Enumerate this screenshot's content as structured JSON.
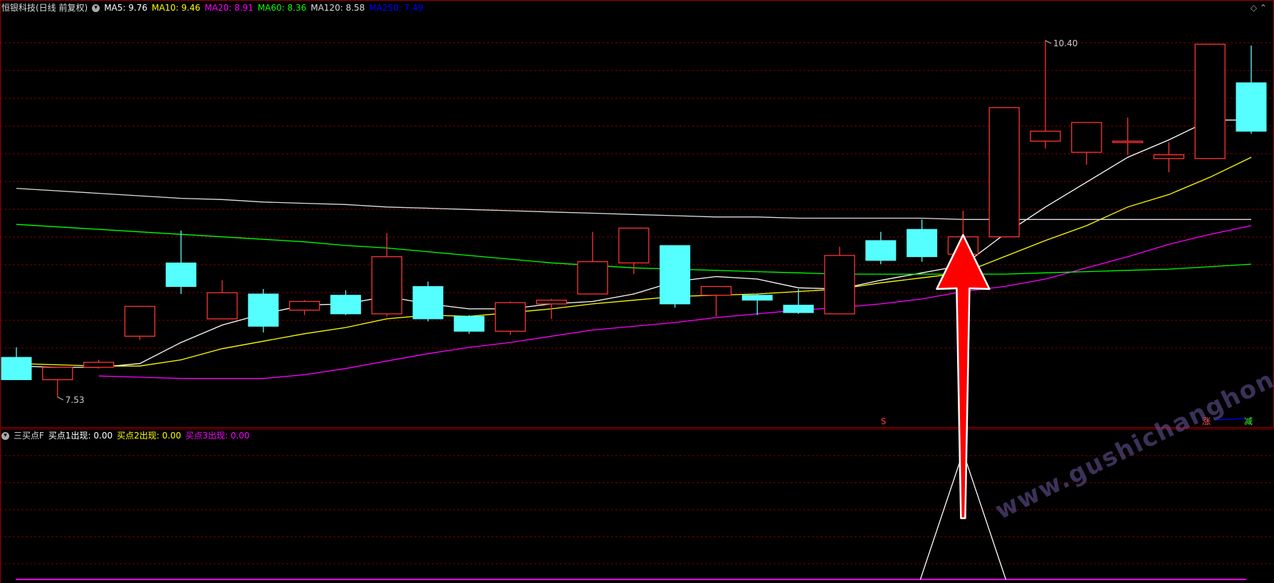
{
  "header": {
    "stock_title": "恒银科技(日线 前复权)",
    "ma_items": [
      {
        "label": "MA5: 9.76",
        "color": "#ffffff"
      },
      {
        "label": "MA10: 9.46",
        "color": "#ffff00"
      },
      {
        "label": "MA20: 8.91",
        "color": "#ff00ff"
      },
      {
        "label": "MA60: 8.36",
        "color": "#00ff00"
      },
      {
        "label": "MA120: 8.58",
        "color": "#dddddd"
      },
      {
        "label": "MA250: 7.49",
        "color": "#0000ff"
      }
    ]
  },
  "indicator": {
    "name": "三买点F",
    "items": [
      {
        "label": "买点1出现: 0.00",
        "color": "#ffffff"
      },
      {
        "label": "买点2出现: 0.00",
        "color": "#ffff00"
      },
      {
        "label": "买点3出现: 0.00",
        "color": "#ff00ff"
      }
    ]
  },
  "markers": {
    "s": "S",
    "zhang": "涨",
    "jian": "减"
  },
  "watermark": "www.gushichanghong.com",
  "colors": {
    "up": "#ff3333",
    "down": "#55ffff",
    "grid": "#7a0000",
    "arrow": "#ff0000"
  },
  "chart_data": {
    "type": "candlestick",
    "y_range": [
      7.3,
      10.6
    ],
    "annotations": {
      "high_label": "10.40",
      "low_label": "7.53"
    },
    "candles": [
      {
        "o": 7.85,
        "h": 7.93,
        "l": 7.69,
        "c": 7.67
      },
      {
        "o": 7.67,
        "h": 7.77,
        "l": 7.53,
        "c": 7.77
      },
      {
        "o": 7.77,
        "h": 7.83,
        "l": 7.76,
        "c": 7.81
      },
      {
        "o": 8.02,
        "h": 8.02,
        "l": 7.99,
        "c": 8.26
      },
      {
        "o": 8.61,
        "h": 8.87,
        "l": 8.36,
        "c": 8.42
      },
      {
        "o": 8.16,
        "h": 8.47,
        "l": 8.16,
        "c": 8.37
      },
      {
        "o": 8.36,
        "h": 8.4,
        "l": 8.05,
        "c": 8.1
      },
      {
        "o": 8.23,
        "h": 8.31,
        "l": 8.19,
        "c": 8.3
      },
      {
        "o": 8.35,
        "h": 8.39,
        "l": 8.19,
        "c": 8.2
      },
      {
        "o": 8.2,
        "h": 8.85,
        "l": 8.18,
        "c": 8.66
      },
      {
        "o": 8.42,
        "h": 8.46,
        "l": 8.14,
        "c": 8.16
      },
      {
        "o": 8.18,
        "h": 8.19,
        "l": 8.04,
        "c": 8.06
      },
      {
        "o": 8.06,
        "h": 8.3,
        "l": 8.03,
        "c": 8.29
      },
      {
        "o": 8.28,
        "h": 8.32,
        "l": 8.16,
        "c": 8.31
      },
      {
        "o": 8.36,
        "h": 8.86,
        "l": 8.36,
        "c": 8.62
      },
      {
        "o": 8.61,
        "h": 8.84,
        "l": 8.52,
        "c": 8.89
      },
      {
        "o": 8.75,
        "h": 8.75,
        "l": 8.25,
        "c": 8.28
      },
      {
        "o": 8.35,
        "h": 8.38,
        "l": 8.18,
        "c": 8.42
      },
      {
        "o": 8.35,
        "h": 8.36,
        "l": 8.19,
        "c": 8.31
      },
      {
        "o": 8.27,
        "h": 8.4,
        "l": 8.2,
        "c": 8.21
      },
      {
        "o": 8.2,
        "h": 8.74,
        "l": 8.2,
        "c": 8.67
      },
      {
        "o": 8.79,
        "h": 8.86,
        "l": 8.6,
        "c": 8.63
      },
      {
        "o": 8.88,
        "h": 8.96,
        "l": 8.62,
        "c": 8.66
      },
      {
        "o": 8.68,
        "h": 9.03,
        "l": 8.55,
        "c": 8.82
      },
      {
        "o": 8.82,
        "h": 9.86,
        "l": 8.82,
        "c": 9.86
      },
      {
        "o": 9.59,
        "h": 10.4,
        "l": 9.53,
        "c": 9.67
      },
      {
        "o": 9.5,
        "h": 9.67,
        "l": 9.4,
        "c": 9.74
      },
      {
        "o": 9.58,
        "h": 9.78,
        "l": 9.48,
        "c": 9.59
      },
      {
        "o": 9.45,
        "h": 9.58,
        "l": 9.34,
        "c": 9.48
      },
      {
        "o": 9.45,
        "h": 10.36,
        "l": 9.45,
        "c": 10.37
      },
      {
        "o": 10.06,
        "h": 10.36,
        "l": 9.65,
        "c": 9.67
      }
    ],
    "ma_lines": [
      {
        "name": "MA5",
        "color": "#ffffff",
        "values": [
          7.78,
          7.77,
          7.77,
          7.8,
          7.97,
          8.11,
          8.2,
          8.27,
          8.28,
          8.34,
          8.28,
          8.24,
          8.24,
          8.28,
          8.3,
          8.36,
          8.46,
          8.5,
          8.48,
          8.41,
          8.4,
          8.47,
          8.53,
          8.59,
          8.84,
          9.06,
          9.26,
          9.46,
          9.6,
          9.76,
          9.76
        ]
      },
      {
        "name": "MA10",
        "color": "#ffff00",
        "values": [
          7.8,
          7.79,
          7.78,
          7.78,
          7.83,
          7.92,
          7.98,
          8.04,
          8.09,
          8.16,
          8.19,
          8.18,
          8.21,
          8.24,
          8.28,
          8.31,
          8.34,
          8.35,
          8.36,
          8.38,
          8.4,
          8.45,
          8.49,
          8.53,
          8.66,
          8.79,
          8.91,
          9.06,
          9.16,
          9.3,
          9.46
        ]
      },
      {
        "name": "MA20",
        "color": "#ff00ff",
        "values": [
          7.7,
          7.69,
          7.68,
          7.68,
          7.68,
          7.71,
          7.76,
          7.82,
          7.88,
          7.93,
          7.97,
          8.02,
          8.07,
          8.1,
          8.13,
          8.17,
          8.2,
          8.23,
          8.25,
          8.28,
          8.32,
          8.38,
          8.42,
          8.48,
          8.57,
          8.66,
          8.76,
          8.84,
          8.91
        ]
      },
      {
        "name": "MA60",
        "color": "#00ff00",
        "values": [
          8.92,
          8.9,
          8.88,
          8.86,
          8.84,
          8.82,
          8.8,
          8.78,
          8.75,
          8.73,
          8.7,
          8.67,
          8.64,
          8.61,
          8.59,
          8.57,
          8.56,
          8.55,
          8.54,
          8.53,
          8.52,
          8.52,
          8.52,
          8.52,
          8.52,
          8.53,
          8.54,
          8.55,
          8.56,
          8.58,
          8.6
        ]
      },
      {
        "name": "MA120",
        "color": "#dddddd",
        "values": [
          9.21,
          9.19,
          9.17,
          9.15,
          9.13,
          9.12,
          9.1,
          9.09,
          9.08,
          9.06,
          9.05,
          9.04,
          9.03,
          9.02,
          9.01,
          9.0,
          8.99,
          8.98,
          8.98,
          8.97,
          8.97,
          8.97,
          8.97,
          8.96,
          8.96,
          8.96,
          8.96,
          8.96,
          8.96,
          8.96,
          8.96
        ]
      }
    ],
    "indicator_peak_index": 23,
    "signal_index": 23
  }
}
